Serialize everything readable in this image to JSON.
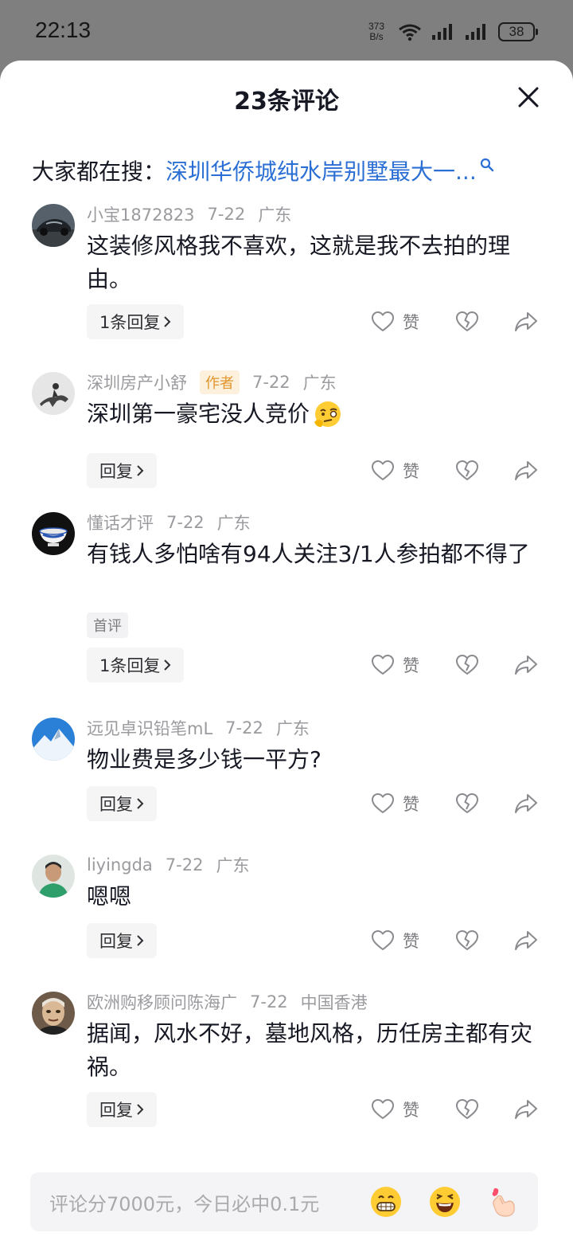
{
  "status": {
    "time": "22:13",
    "net_speed_value": "373",
    "net_speed_unit": "B/s",
    "battery": "38"
  },
  "sheet": {
    "title": "23条评论",
    "search_prefix": "大家都在搜：",
    "search_query": "深圳华侨城纯水岸别墅最大一..."
  },
  "comments": [
    {
      "user": "小宝1872823",
      "date": "7-22",
      "region": "广东",
      "text": "这装修风格我不喜欢，这就是我不去拍的理由。",
      "reply": "1条回复",
      "like_label": "赞"
    },
    {
      "user": "深圳房产小舒",
      "badge": "作者",
      "date": "7-22",
      "region": "广东",
      "text": "深圳第一豪宅没人竞价",
      "reply": "回复",
      "like_label": "赞"
    },
    {
      "user": "懂话才评",
      "date": "7-22",
      "region": "广东",
      "text": "有钱人多怕啥有94人关注3/1人参拍都不得了",
      "tag": "首评",
      "reply": "1条回复",
      "like_label": "赞"
    },
    {
      "user": "远见卓识铅笔mL",
      "date": "7-22",
      "region": "广东",
      "text": "物业费是多少钱一平方?",
      "reply": "回复",
      "like_label": "赞"
    },
    {
      "user": "liyingda",
      "date": "7-22",
      "region": "广东",
      "text": "嗯嗯",
      "reply": "回复",
      "like_label": "赞"
    },
    {
      "user": "欧洲购移顾问陈海广",
      "date": "7-22",
      "region": "中国香港",
      "text": "据闻，风水不好，墓地风格，历任房主都有灾祸。",
      "reply": "回复",
      "like_label": "赞"
    }
  ],
  "input": {
    "placeholder": "评论分7000元，今日必中0.1元"
  },
  "colors": {
    "link": "#2b6fd4",
    "badge_text": "#e0952e",
    "badge_bg": "#fdf0dc",
    "meta": "#9b9b9f"
  },
  "icons": [
    "close-icon",
    "search-icon",
    "heart-icon",
    "broken-heart-icon",
    "share-icon",
    "grin-emoji-icon",
    "laugh-emoji-icon",
    "finger-heart-icon",
    "thinking-emoji-icon"
  ]
}
